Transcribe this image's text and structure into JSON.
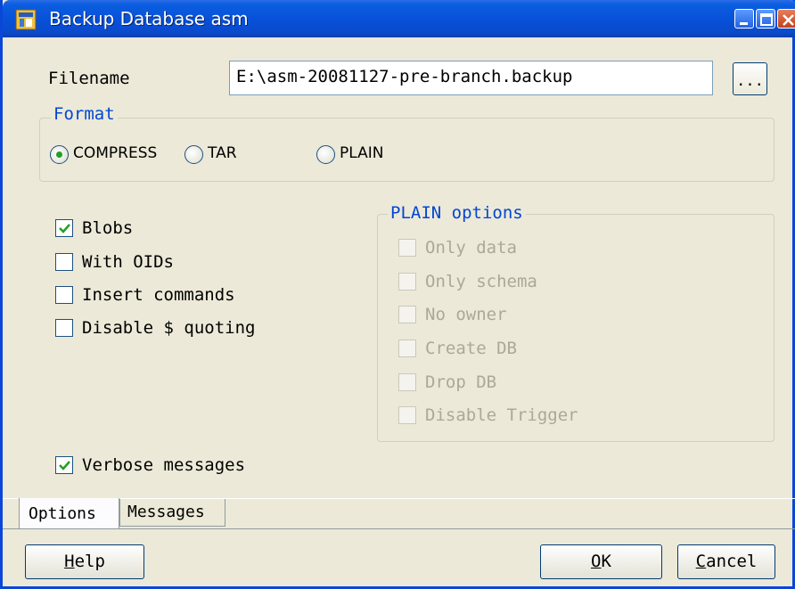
{
  "window": {
    "title": "Backup Database asm"
  },
  "filename": {
    "label": "Filename",
    "value": "E:\\asm-20081127-pre-branch.backup",
    "browse_label": "..."
  },
  "format": {
    "title": "Format",
    "options": [
      {
        "label": "COMPRESS",
        "selected": true
      },
      {
        "label": "TAR",
        "selected": false
      },
      {
        "label": "PLAIN",
        "selected": false
      }
    ]
  },
  "options": {
    "blobs": {
      "label": "Blobs",
      "checked": true
    },
    "with_oids": {
      "label": "With OIDs",
      "checked": false
    },
    "insert_commands": {
      "label": "Insert commands",
      "checked": false
    },
    "disable_quoting": {
      "label": "Disable $ quoting",
      "checked": false
    },
    "verbose": {
      "label": "Verbose messages",
      "checked": true
    }
  },
  "plain_options": {
    "title": "PLAIN options",
    "items": [
      {
        "label": "Only data",
        "checked": false,
        "enabled": false
      },
      {
        "label": "Only schema",
        "checked": false,
        "enabled": false
      },
      {
        "label": "No owner",
        "checked": false,
        "enabled": false
      },
      {
        "label": "Create DB",
        "checked": false,
        "enabled": false
      },
      {
        "label": "Drop DB",
        "checked": false,
        "enabled": false
      },
      {
        "label": "Disable Trigger",
        "checked": false,
        "enabled": false
      }
    ]
  },
  "tabs": [
    {
      "label": "Options",
      "active": true
    },
    {
      "label": "Messages",
      "active": false
    }
  ],
  "buttons": {
    "help_u": "H",
    "help_rest": "elp",
    "ok_u": "O",
    "ok_rest": "K",
    "cancel_u": "C",
    "cancel_rest": "ancel"
  },
  "colors": {
    "accent": "#0046d5",
    "checkmark": "#21a121",
    "titlebar": "#0750d8"
  }
}
